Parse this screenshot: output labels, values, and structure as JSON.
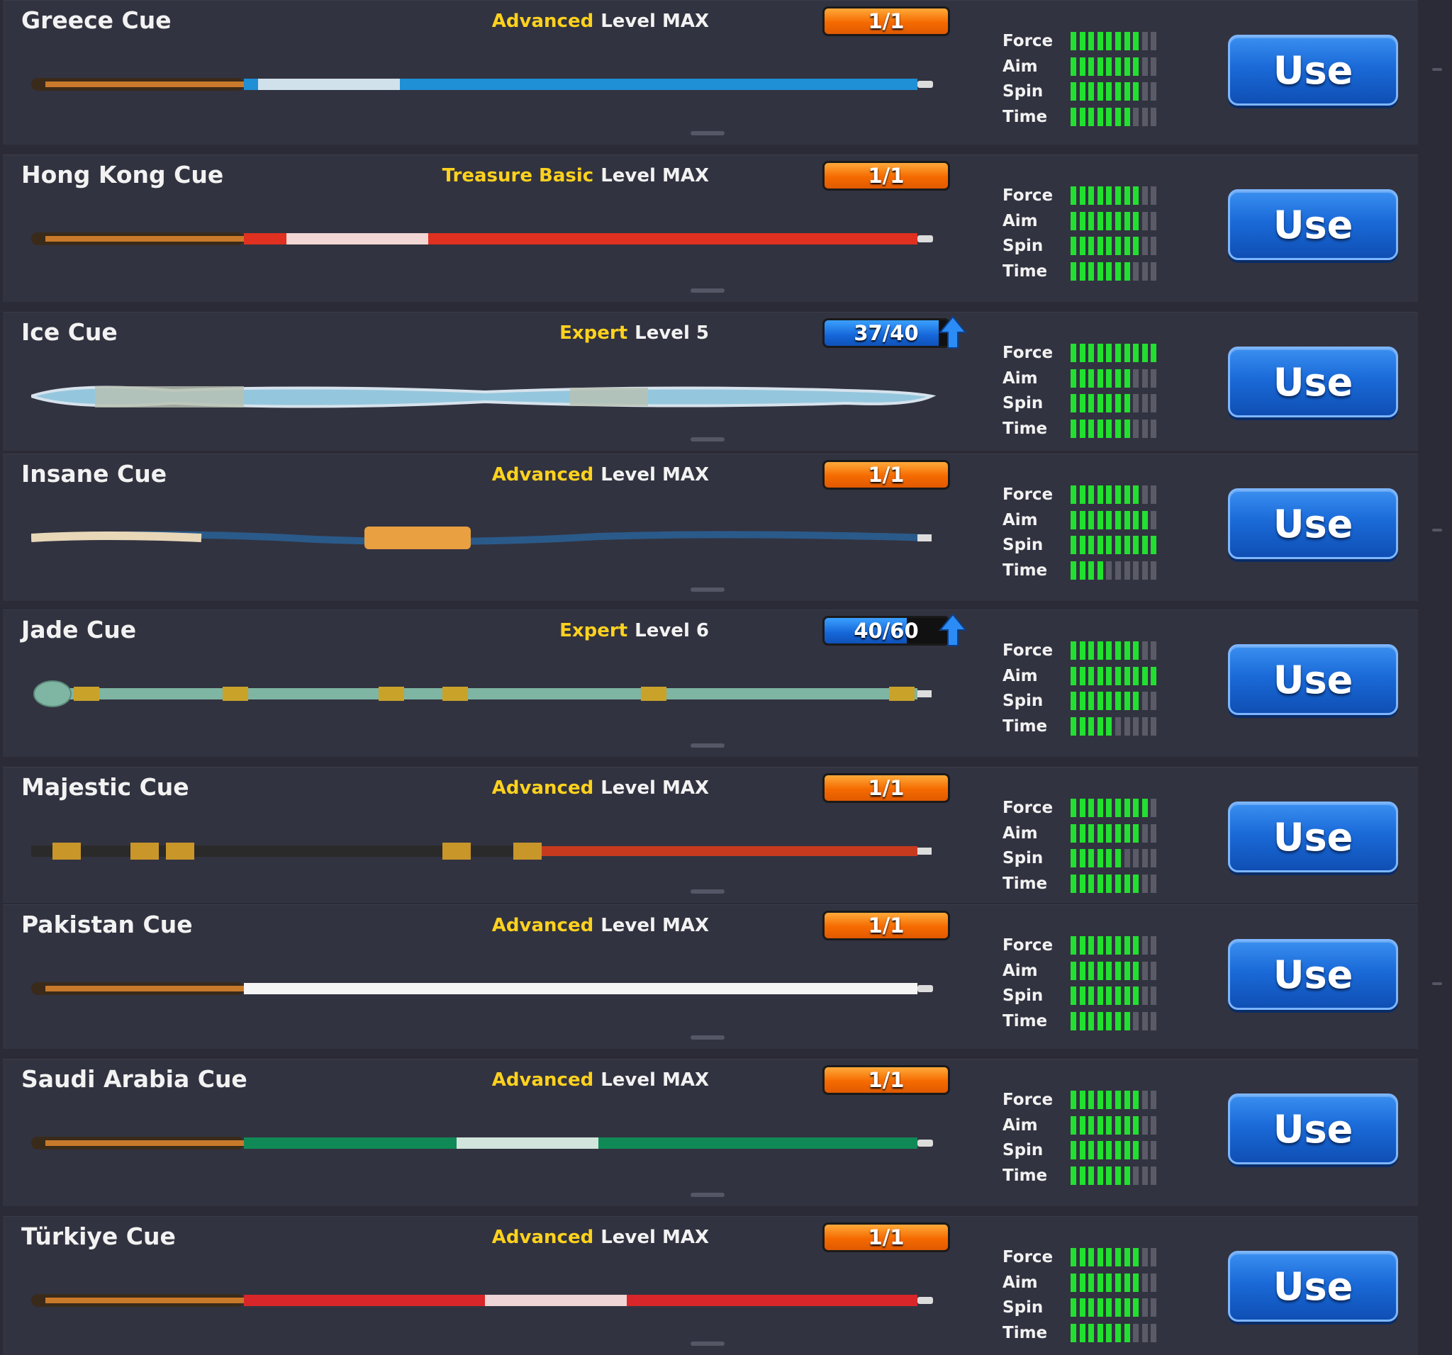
{
  "colors": {
    "background": "#2a2b36",
    "card": "#323340",
    "category_yellow": "#ffd21e",
    "progress_orange": "#f56a00",
    "progress_blue": "#1566d8",
    "stat_on": "#22e030",
    "stat_off": "#5a5b66",
    "use_button": "#1a6ad8"
  },
  "stat_labels": [
    "Force",
    "Aim",
    "Spin",
    "Time"
  ],
  "cues": [
    {
      "name": "Greece Cue",
      "category": "Advanced",
      "level": "Level MAX",
      "progress": "1/1",
      "progress_fraction": 1,
      "progress_style": "orange",
      "upgrade_icon": false,
      "stats": [
        8,
        8,
        8,
        7
      ],
      "use_label": "Use",
      "cue_colors": [
        "#1f8fd6",
        "#f0f0f0"
      ]
    },
    {
      "name": "Hong Kong Cue",
      "category": "Treasure Basic",
      "level": "Level MAX",
      "progress": "1/1",
      "progress_fraction": 1,
      "progress_style": "orange",
      "upgrade_icon": false,
      "stats": [
        8,
        8,
        8,
        7
      ],
      "use_label": "Use",
      "cue_colors": [
        "#e03020",
        "#f5f5f5"
      ]
    },
    {
      "name": "Ice Cue",
      "category": "Expert",
      "level": "Level 5",
      "progress": "37/40",
      "progress_fraction": 0.925,
      "progress_style": "blue",
      "upgrade_icon": true,
      "stats": [
        10,
        7,
        7,
        7
      ],
      "use_label": "Use",
      "cue_colors": [
        "#9fd8f0",
        "#e8f6ff"
      ]
    },
    {
      "name": "Insane Cue",
      "category": "Advanced",
      "level": "Level MAX",
      "progress": "1/1",
      "progress_fraction": 1,
      "progress_style": "orange",
      "upgrade_icon": false,
      "stats": [
        8,
        9,
        10,
        4
      ],
      "use_label": "Use",
      "cue_colors": [
        "#2a5a8a",
        "#e8d8b8"
      ]
    },
    {
      "name": "Jade Cue",
      "category": "Expert",
      "level": "Level 6",
      "progress": "40/60",
      "progress_fraction": 0.667,
      "progress_style": "blue",
      "upgrade_icon": true,
      "stats": [
        8,
        10,
        8,
        5
      ],
      "use_label": "Use",
      "cue_colors": [
        "#7fb5a3",
        "#c9a22a"
      ]
    },
    {
      "name": "Majestic Cue",
      "category": "Advanced",
      "level": "Level MAX",
      "progress": "1/1",
      "progress_fraction": 1,
      "progress_style": "orange",
      "upgrade_icon": false,
      "stats": [
        9,
        8,
        6,
        8
      ],
      "use_label": "Use",
      "cue_colors": [
        "#2a2a2a",
        "#c83a1e"
      ]
    },
    {
      "name": "Pakistan Cue",
      "category": "Advanced",
      "level": "Level MAX",
      "progress": "1/1",
      "progress_fraction": 1,
      "progress_style": "orange",
      "upgrade_icon": false,
      "stats": [
        8,
        8,
        8,
        7
      ],
      "use_label": "Use",
      "cue_colors": [
        "#f5f5f5",
        "#0f8a3c"
      ]
    },
    {
      "name": "Saudi Arabia Cue",
      "category": "Advanced",
      "level": "Level MAX",
      "progress": "1/1",
      "progress_fraction": 1,
      "progress_style": "orange",
      "upgrade_icon": false,
      "stats": [
        8,
        8,
        8,
        7
      ],
      "use_label": "Use",
      "cue_colors": [
        "#0f8a56",
        "#f5f5f5"
      ]
    },
    {
      "name": "Türkiye Cue",
      "category": "Advanced",
      "level": "Level MAX",
      "progress": "1/1",
      "progress_fraction": 1,
      "progress_style": "orange",
      "upgrade_icon": false,
      "stats": [
        8,
        8,
        8,
        7
      ],
      "use_label": "Use",
      "cue_colors": [
        "#d8262a",
        "#f5f5f5"
      ]
    }
  ]
}
